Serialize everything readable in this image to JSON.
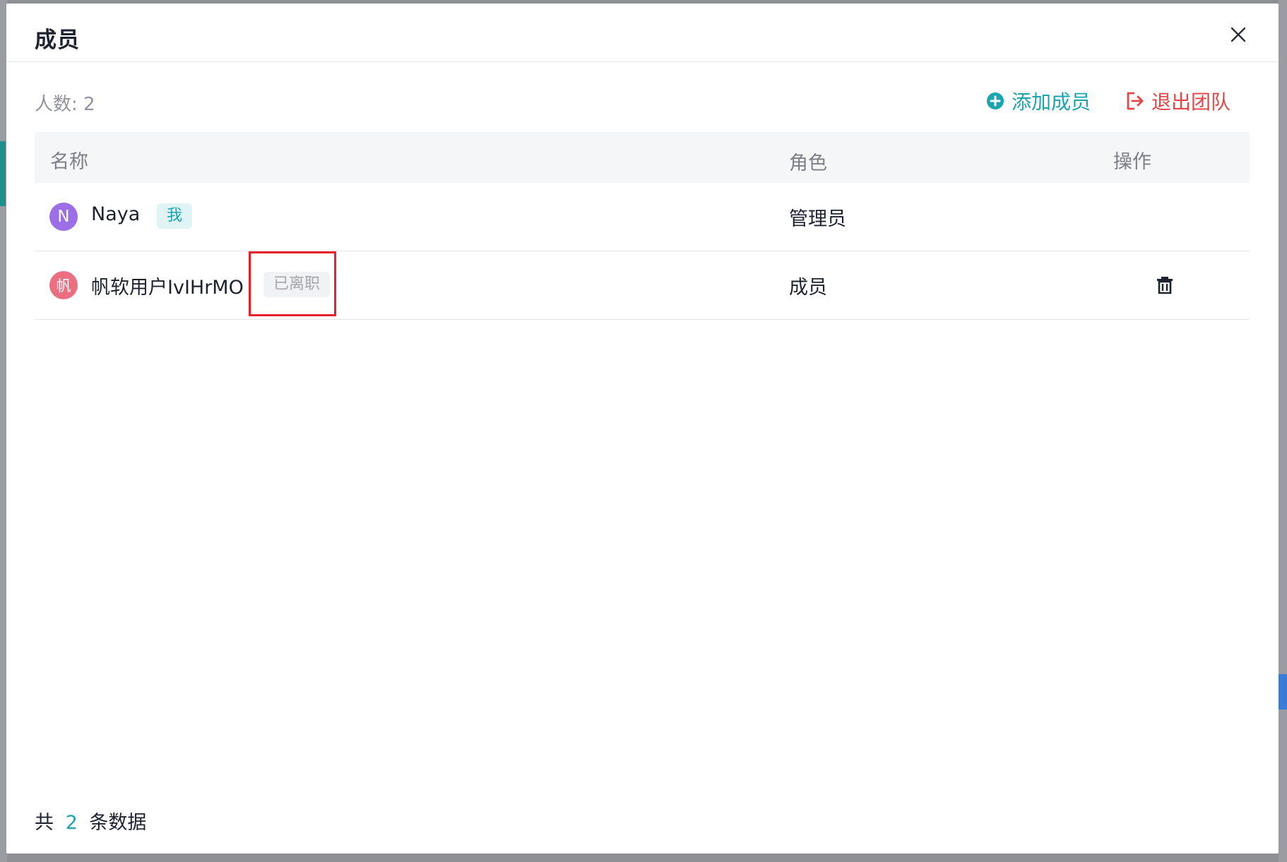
{
  "modal": {
    "title": "成员",
    "close_icon": "close-icon"
  },
  "toolbar": {
    "count_label": "人数: 2",
    "add_member_label": "添加成员",
    "add_member_icon": "plus-circle-icon",
    "exit_team_label": "退出团队",
    "exit_team_icon": "logout-icon"
  },
  "table": {
    "columns": [
      "名称",
      "角色",
      "操作"
    ],
    "rows": [
      {
        "avatar_text": "N",
        "avatar_color": "#9c6ee8",
        "name": "Naya",
        "tag": "我",
        "role": "管理员",
        "actions": []
      },
      {
        "avatar_text": "帆",
        "avatar_color": "#ec6f81",
        "name": "帆软用户IvIHrMO",
        "tag": "已离职",
        "role": "成员",
        "actions": [
          "trash-icon"
        ]
      }
    ]
  },
  "footer": {
    "prefix": "共",
    "total": "2",
    "suffix": "条数据"
  },
  "colors": {
    "accent": "#1aa5b1",
    "danger": "#e64545",
    "highlight": "#e8202a"
  }
}
